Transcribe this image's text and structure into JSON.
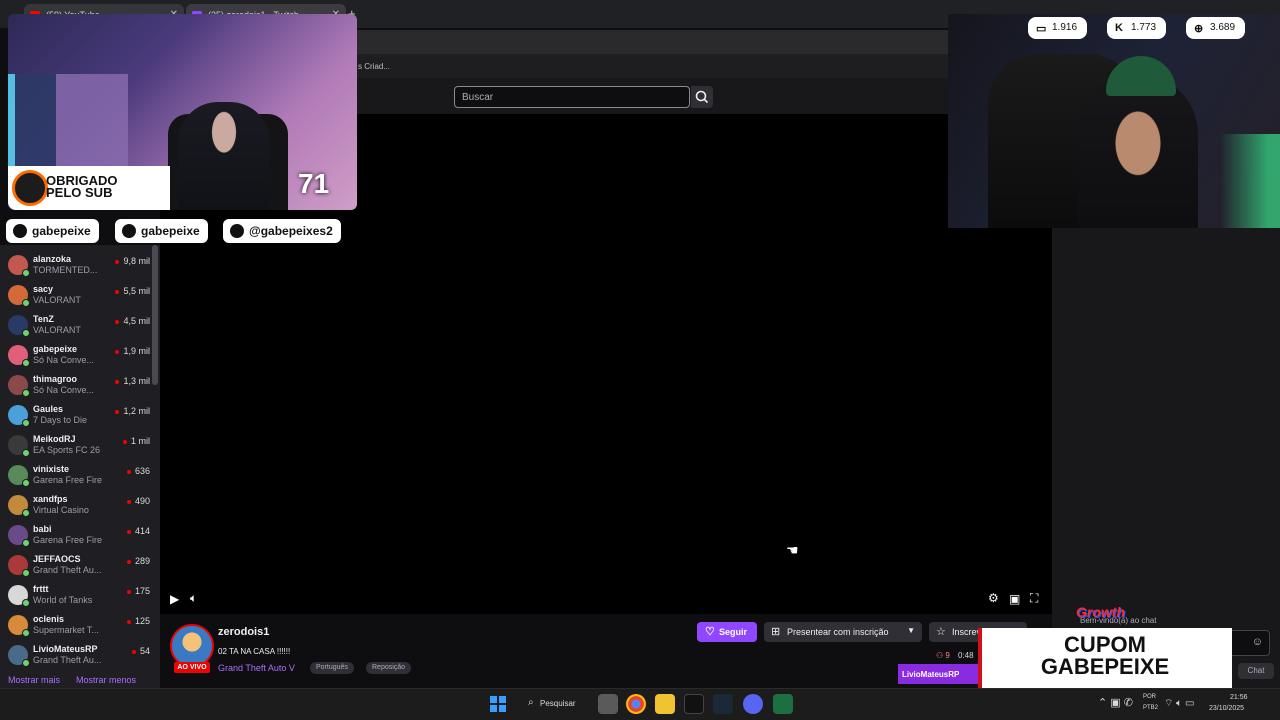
{
  "browser": {
    "tabs": [
      {
        "title": "(59) YouTube",
        "color": "#ff0000"
      },
      {
        "title": "(25) zerodois1 - Twitch",
        "color": "#9147ff"
      }
    ],
    "new_tab_label": "+"
  },
  "twitch": {
    "breadcrumb_fragment": "s Criad...",
    "search_placeholder": "Buscar",
    "sidebar": {
      "channels": [
        {
          "name": "alanzoka",
          "game": "TORMENTED...",
          "viewers": "9,8 mil",
          "color": "#c2584f"
        },
        {
          "name": "sacy",
          "game": "VALORANT",
          "viewers": "5,5 mil",
          "color": "#d46a3a"
        },
        {
          "name": "TenZ",
          "game": "VALORANT",
          "viewers": "4,5 mil",
          "color": "#2a3a66"
        },
        {
          "name": "gabepeixe",
          "game": "Só Na Conve...",
          "viewers": "1,9 mil",
          "color": "#e0607a"
        },
        {
          "name": "thimagroo",
          "game": "Só Na Conve...",
          "viewers": "1,3 mil",
          "color": "#8a4a4a"
        },
        {
          "name": "Gaules",
          "game": "7 Days to Die",
          "viewers": "1,2 mil",
          "color": "#4aa0d8"
        },
        {
          "name": "MeikodRJ",
          "game": "EA Sports FC 26",
          "viewers": "1 mil",
          "color": "#3a3a3a"
        },
        {
          "name": "vinixiste",
          "game": "Garena Free Fire",
          "viewers": "636",
          "color": "#5a8a5a"
        },
        {
          "name": "xandfps",
          "game": "Virtual Casino",
          "viewers": "490",
          "color": "#c28a3a"
        },
        {
          "name": "babi",
          "game": "Garena Free Fire",
          "viewers": "414",
          "color": "#6a4a8a"
        },
        {
          "name": "JEFFAOCS",
          "game": "Grand Theft Au...",
          "viewers": "289",
          "color": "#aa3a3a"
        },
        {
          "name": "frttt",
          "game": "World of Tanks",
          "viewers": "175",
          "color": "#d8d8d8"
        },
        {
          "name": "oclenis",
          "game": "Supermarket T...",
          "viewers": "125",
          "color": "#d88a3a"
        },
        {
          "name": "LivioMateusRP",
          "game": "Grand Theft Au...",
          "viewers": "54",
          "color": "#4a6a8a"
        }
      ],
      "show_more": "Mostrar mais",
      "show_less": "Mostrar menos"
    },
    "stream": {
      "streamer": "zerodois1",
      "live_badge": "AO VIVO",
      "title": "02 TA NA CASA !!!!!!",
      "game": "Grand Theft Auto V",
      "tags": [
        "Português",
        "Reposição"
      ],
      "follow_label": "Seguir",
      "gift_label": "Presentear com inscrição",
      "subscribe_label": "Inscrever-se",
      "viewers": "9",
      "uptime": "0:48",
      "chat_user": "LivioMateusRP"
    },
    "chat": {
      "welcome_text": "Bem-vindo(a) ao chat",
      "chat_button": "Chat"
    }
  },
  "overlay": {
    "sub_count": "71",
    "thanks_line1": "OBRIGADO",
    "thanks_line2": "PELO SUB",
    "socials": [
      {
        "handle": "gabepeixe",
        "icon": "youtube-icon"
      },
      {
        "handle": "gabepeixe",
        "icon": "instagram-icon"
      },
      {
        "handle": "@gabepeixes2",
        "icon": "tiktok-icon"
      }
    ],
    "stats": [
      {
        "value": "1.916",
        "icon": "twitch-icon",
        "glyph": "▭"
      },
      {
        "value": "1.773",
        "icon": "kick-icon",
        "glyph": "K"
      },
      {
        "value": "3.689",
        "icon": "globe-icon",
        "glyph": "⊕"
      }
    ],
    "coupon_brand": "Growth",
    "coupon_line1": "CUPOM",
    "coupon_line2": "GABEPEIXE"
  },
  "taskbar": {
    "search_label": "Pesquisar",
    "lang_line1": "POR",
    "lang_line2": "PTB2",
    "time": "21:56",
    "date": "23/10/2025"
  }
}
